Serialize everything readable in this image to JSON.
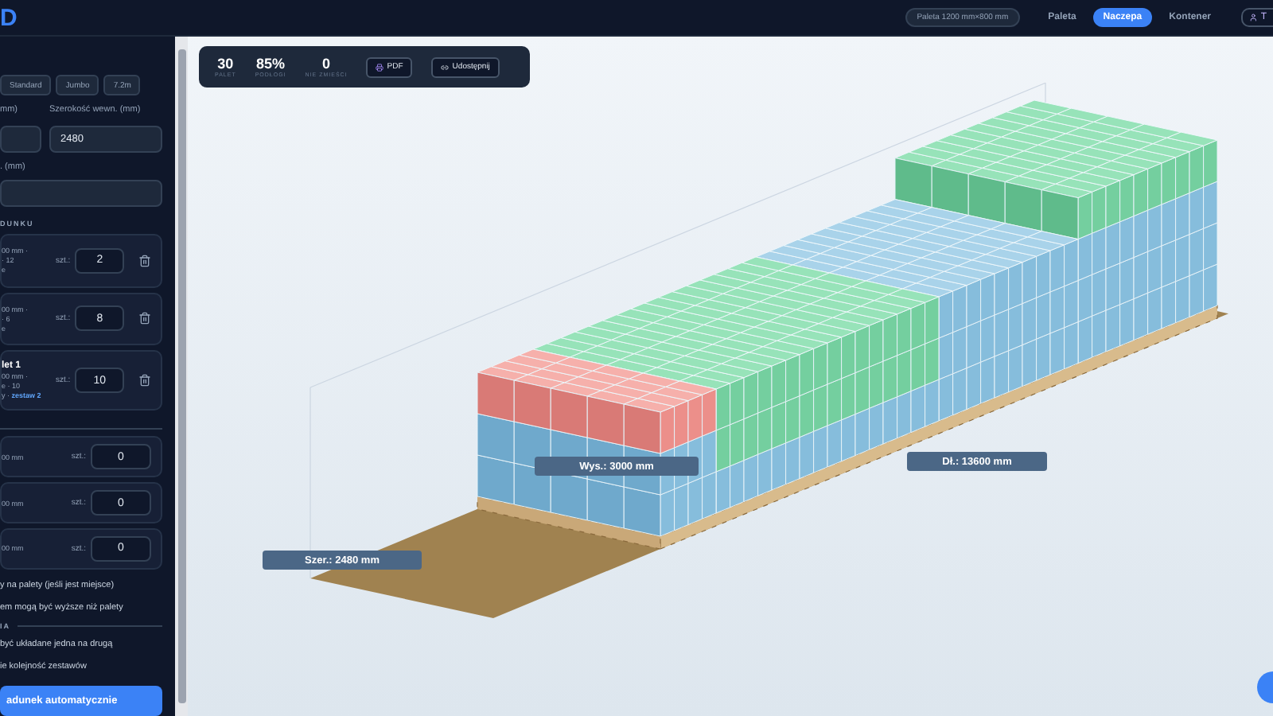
{
  "header": {
    "logo": "D",
    "pallet_badge": "Paleta 1200 mm×800 mm",
    "nav": [
      {
        "label": "Paleta",
        "selected": false
      },
      {
        "label": "Naczepa",
        "selected": true
      },
      {
        "label": "Kontener",
        "selected": false
      }
    ],
    "user_button": "T"
  },
  "sidebar": {
    "presets": [
      "Standard",
      "Jumbo",
      "7.2m"
    ],
    "fields": [
      {
        "label": "mm)"
      },
      {
        "label": "Szerokość wewn. (mm)",
        "value": "2480"
      }
    ],
    "height_field": {
      "label": ". (mm)"
    },
    "cargo_section": "DUNKU",
    "cargo_items": [
      {
        "lines": [
          "00 mm ·",
          "· 12",
          "e"
        ],
        "unit": "szt.:",
        "count": "2"
      },
      {
        "lines": [
          "00 mm ·",
          "· 6",
          "e"
        ],
        "unit": "szt.:",
        "count": "8"
      },
      {
        "title": "let 1",
        "lines": [
          "00 mm ·",
          "e · 10"
        ],
        "set_prefix": "y ·",
        "set": "zestaw 2",
        "unit": "szt.:",
        "count": "10"
      }
    ],
    "extra_items": [
      {
        "size": "00 mm",
        "unit": "szt.:",
        "count": "0"
      },
      {
        "size": "00 mm",
        "unit": "szt.:",
        "count": "0"
      },
      {
        "size": "00 mm",
        "unit": "szt.:",
        "count": "0"
      }
    ],
    "options": [
      "y na palety (jeśli jest miejsce)",
      "em mogą być wyższe niż palety"
    ],
    "options_section": "IA",
    "options2": [
      "być układane jedna na drugą",
      "ie kolejność zestawów"
    ],
    "auto_button": "adunek automatycznie"
  },
  "stats": [
    {
      "value": "30",
      "label": "PALET"
    },
    {
      "value": "85%",
      "label": "PODŁOGI"
    },
    {
      "value": "0",
      "label": "NIE ZMIEŚCI"
    }
  ],
  "actions": [
    "PDF",
    "Udostępnij"
  ],
  "dimensions": {
    "height": "Wys.: 3000 mm",
    "length": "Dł.: 13600 mm",
    "width": "Szer.: 2480 mm"
  }
}
